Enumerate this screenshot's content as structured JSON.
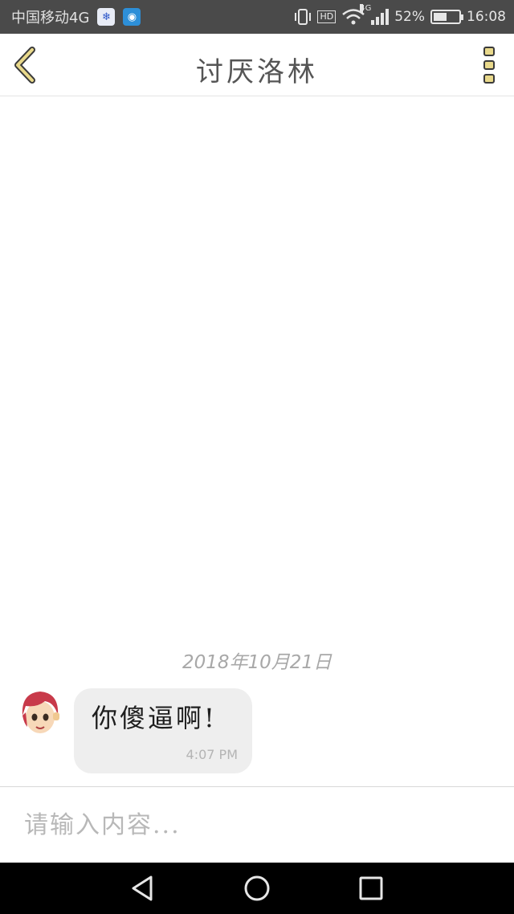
{
  "status_bar": {
    "carrier": "中国移动4G",
    "network_label": "4G",
    "battery_percent_text": "52%",
    "battery_level": 0.52,
    "time": "16:08",
    "hd_label": "HD"
  },
  "header": {
    "title": "讨厌洛林"
  },
  "chat": {
    "date_separator": "2018年10月21日",
    "messages": [
      {
        "text": "你傻逼啊!",
        "time": "4:07 PM",
        "sender": "other"
      }
    ]
  },
  "input": {
    "placeholder": "请输入内容..."
  },
  "colors": {
    "status_bar_bg": "#4a4a4a",
    "bubble_bg": "#eeeeee",
    "accent_yellow": "#e9d98b",
    "nav_bar_bg": "#000000"
  },
  "icons": {
    "back": "chevron-left-icon",
    "menu": "more-vertical-icon",
    "nav_back": "triangle-back-icon",
    "nav_home": "circle-home-icon",
    "nav_recent": "square-recent-icon"
  }
}
